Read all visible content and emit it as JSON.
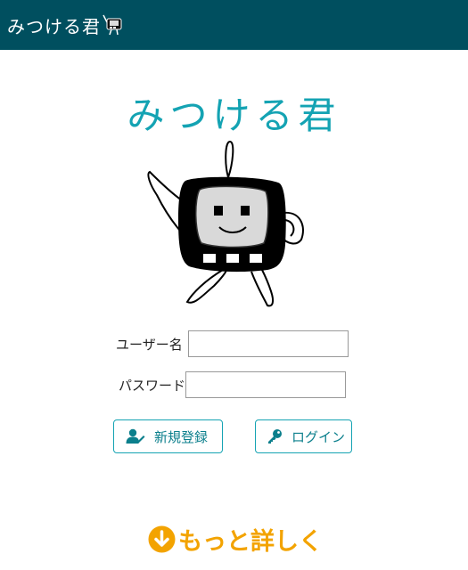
{
  "header": {
    "logo_text": "みつける君"
  },
  "main": {
    "title": "みつける君"
  },
  "form": {
    "username_label": "ユーザー名",
    "username_value": "",
    "password_label": "パスワード",
    "password_value": ""
  },
  "buttons": {
    "register_label": "新規登録",
    "login_label": "ログイン"
  },
  "more_link": {
    "label": "もっと詳しく"
  },
  "colors": {
    "header_bg": "#004f5f",
    "title": "#14a3b3",
    "button_border": "#14a3b3",
    "button_text": "#0b7f8c",
    "more_link": "#f3a300"
  },
  "icons": [
    "mascot-icon",
    "add-user-icon",
    "key-icon",
    "arrow-circle-down-icon"
  ]
}
